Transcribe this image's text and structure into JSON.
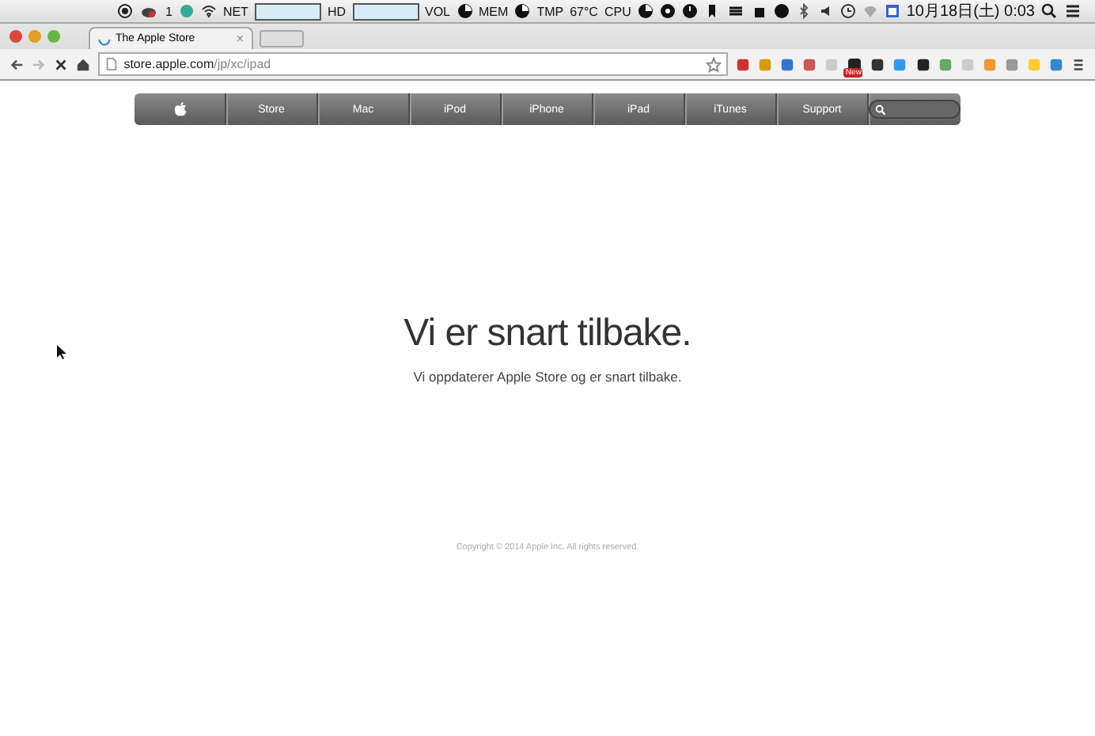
{
  "menubar": {
    "badge": "1",
    "meters": [
      {
        "kind": "graph",
        "label": "NET"
      },
      {
        "kind": "graph",
        "label": "HD"
      },
      {
        "kind": "pie",
        "label": "VOL"
      },
      {
        "kind": "pie",
        "label": "MEM"
      },
      {
        "kind": "plain",
        "label": "TMP"
      },
      {
        "kind": "plain",
        "label": "67°C"
      },
      {
        "kind": "pie",
        "label": "CPU"
      }
    ],
    "clock": "10月18日(土) 0:03"
  },
  "browser": {
    "tab": {
      "title": "The Apple Store",
      "close": "×"
    },
    "url": {
      "host": "store.apple.com",
      "path": "/jp/xc/ipad"
    },
    "extension_badge": "New"
  },
  "page": {
    "nav": [
      "Store",
      "Mac",
      "iPod",
      "iPhone",
      "iPad",
      "iTunes",
      "Support"
    ],
    "heading": "Vi er snart tilbake.",
    "subtitle": "Vi oppdaterer Apple Store og er snart tilbake.",
    "copyright": "Copyright © 2014 Apple Inc. All rights reserved."
  }
}
